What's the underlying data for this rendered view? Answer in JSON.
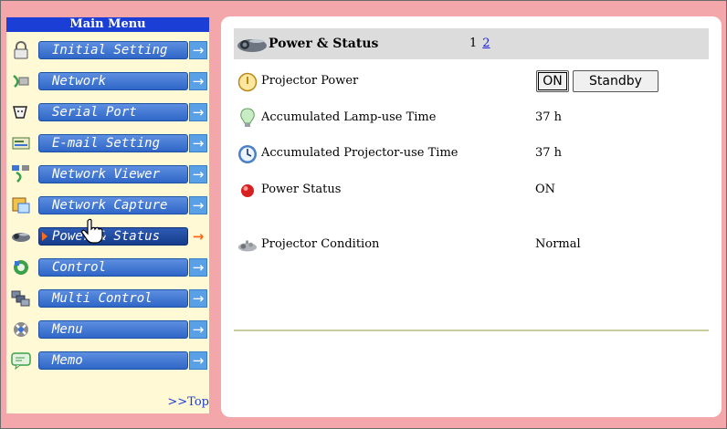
{
  "sidebar": {
    "title": "Main Menu",
    "items": [
      {
        "label": "Initial Setting",
        "icon": "lock-icon",
        "arrow": "→"
      },
      {
        "label": "Network",
        "icon": "network-icon",
        "arrow": "→"
      },
      {
        "label": "Serial Port",
        "icon": "serial-port-icon",
        "arrow": "→"
      },
      {
        "label": "E-mail Setting",
        "icon": "email-icon",
        "arrow": "→"
      },
      {
        "label": "Network Viewer",
        "icon": "network-viewer-icon",
        "arrow": "→"
      },
      {
        "label": "Network Capture",
        "icon": "network-capture-icon",
        "arrow": "→"
      },
      {
        "label": "Power & Status",
        "icon": "projector-icon",
        "arrow": "→",
        "active": true
      },
      {
        "label": "Control",
        "icon": "control-icon",
        "arrow": "→"
      },
      {
        "label": "Multi Control",
        "icon": "multi-control-icon",
        "arrow": "→"
      },
      {
        "label": "Menu",
        "icon": "menu-icon",
        "arrow": "→"
      },
      {
        "label": "Memo",
        "icon": "memo-icon",
        "arrow": "→"
      }
    ],
    "top_link": ">>Top"
  },
  "main": {
    "header": {
      "title": "Power & Status",
      "icon": "projector-icon",
      "page_current": "1",
      "page_link": "2"
    },
    "rows": {
      "power": {
        "label": "Projector Power",
        "icon": "power-icon",
        "on_label": "ON",
        "standby_label": "Standby"
      },
      "lamp": {
        "label": "Accumulated Lamp-use Time",
        "icon": "lamp-icon",
        "value": "37 h"
      },
      "projector_time": {
        "label": "Accumulated Projector-use Time",
        "icon": "clock-icon",
        "value": "37 h"
      },
      "status": {
        "label": "Power Status",
        "icon": "status-light-icon",
        "value": "ON"
      },
      "condition": {
        "label": "Projector Condition",
        "icon": "condition-icon",
        "value": "Normal"
      }
    }
  },
  "colors": {
    "background": "#f4a7aa",
    "sidebar_bg": "#fff9d6",
    "menu_title_bg": "#1b3fd6",
    "menu_button": "#3a74d4",
    "active_arrow": "#ff6a1a",
    "header_bar": "#dcdcdc"
  }
}
